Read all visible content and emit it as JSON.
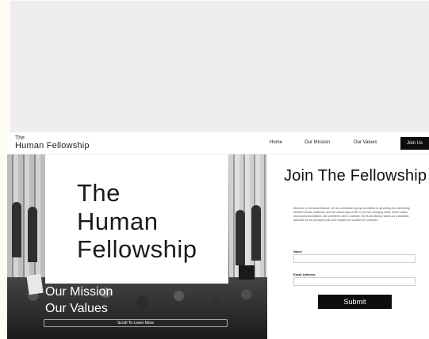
{
  "header": {
    "logo_the": "The",
    "logo_name": "Human Fellowship",
    "nav": [
      "Home",
      "Our Mission",
      "Our Values"
    ],
    "join_label": "Join Us"
  },
  "hero": {
    "title_lines": [
      "The",
      "Human",
      "Fellowship"
    ],
    "links": [
      "Our Mission",
      "Our Values"
    ],
    "scroll_label": "Scroll To Learn More"
  },
  "form": {
    "title": "Join The Fellowship",
    "description": "Welcome to the Moral Alliance. We are a dedicated group committed to upholding and celebrating Western morals, traditions, and the Liberal ways of life. In an ever-changing world, where values and cultural foundations can sometimes seem uncertain, the Moral Alliance stands as a steadfast advocate for the principles that have shaped our societies for centuries.",
    "name_label": "Name",
    "name_value": "",
    "email_label": "Email Address",
    "email_value": "",
    "submit_label": "Submit"
  },
  "colors": {
    "page_background": "#fefbf2",
    "top_band": "#eeeeee",
    "button": "#0d0d0d"
  }
}
